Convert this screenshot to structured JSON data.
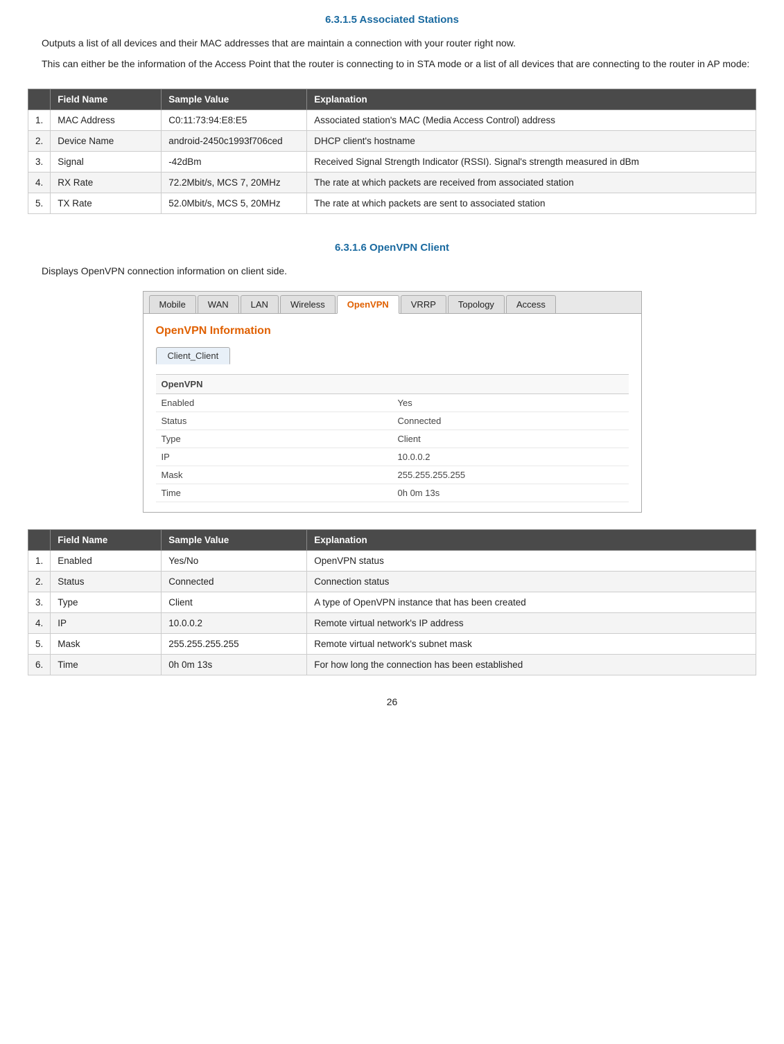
{
  "section635": {
    "heading": "6.3.1.5   Associated Stations",
    "para1": "Outputs a list of all devices and their MAC addresses that are maintain a connection with your router right now.",
    "para2": "This can either be the information of the Access Point that the router is connecting to in STA mode or a list of all devices that are connecting to the router in AP mode:",
    "table": {
      "headers": [
        "",
        "Field Name",
        "Sample Value",
        "Explanation"
      ],
      "rows": [
        [
          "1.",
          "MAC Address",
          "C0:11:73:94:E8:E5",
          "Associated station's MAC (Media Access Control) address"
        ],
        [
          "2.",
          "Device Name",
          "android-2450c1993f706ced",
          "DHCP client's hostname"
        ],
        [
          "3.",
          "Signal",
          "-42dBm",
          "Received Signal Strength Indicator (RSSI). Signal's strength measured in dBm"
        ],
        [
          "4.",
          "RX Rate",
          "72.2Mbit/s, MCS 7, 20MHz",
          "The rate at which packets are received from associated station"
        ],
        [
          "5.",
          "TX Rate",
          "52.0Mbit/s, MCS 5, 20MHz",
          "The rate at which packets are sent to associated station"
        ]
      ]
    }
  },
  "section636": {
    "heading": "6.3.1.6   OpenVPN Client",
    "para1": "Displays OpenVPN connection information on client side.",
    "ui": {
      "tabs": [
        "Mobile",
        "WAN",
        "LAN",
        "Wireless",
        "OpenVPN",
        "VRRP",
        "Topology",
        "Access"
      ],
      "active_tab": "OpenVPN",
      "panel_title": "OpenVPN Information",
      "sub_tab": "Client_Client",
      "info_section_label": "OpenVPN",
      "rows": [
        {
          "label": "Enabled",
          "value": "Yes"
        },
        {
          "label": "Status",
          "value": "Connected"
        },
        {
          "label": "Type",
          "value": "Client"
        },
        {
          "label": "IP",
          "value": "10.0.0.2"
        },
        {
          "label": "Mask",
          "value": "255.255.255.255"
        },
        {
          "label": "Time",
          "value": "0h 0m 13s"
        }
      ]
    },
    "table": {
      "headers": [
        "",
        "Field Name",
        "Sample Value",
        "Explanation"
      ],
      "rows": [
        [
          "1.",
          "Enabled",
          "Yes/No",
          "OpenVPN status"
        ],
        [
          "2.",
          "Status",
          "Connected",
          "Connection status"
        ],
        [
          "3.",
          "Type",
          "Client",
          "A type of OpenVPN instance that has been created"
        ],
        [
          "4.",
          "IP",
          "10.0.0.2",
          "Remote virtual network's IP address"
        ],
        [
          "5.",
          "Mask",
          "255.255.255.255",
          "Remote virtual network's subnet mask"
        ],
        [
          "6.",
          "Time",
          "0h 0m 13s",
          "For how long the connection has been established"
        ]
      ]
    }
  },
  "page_number": "26"
}
